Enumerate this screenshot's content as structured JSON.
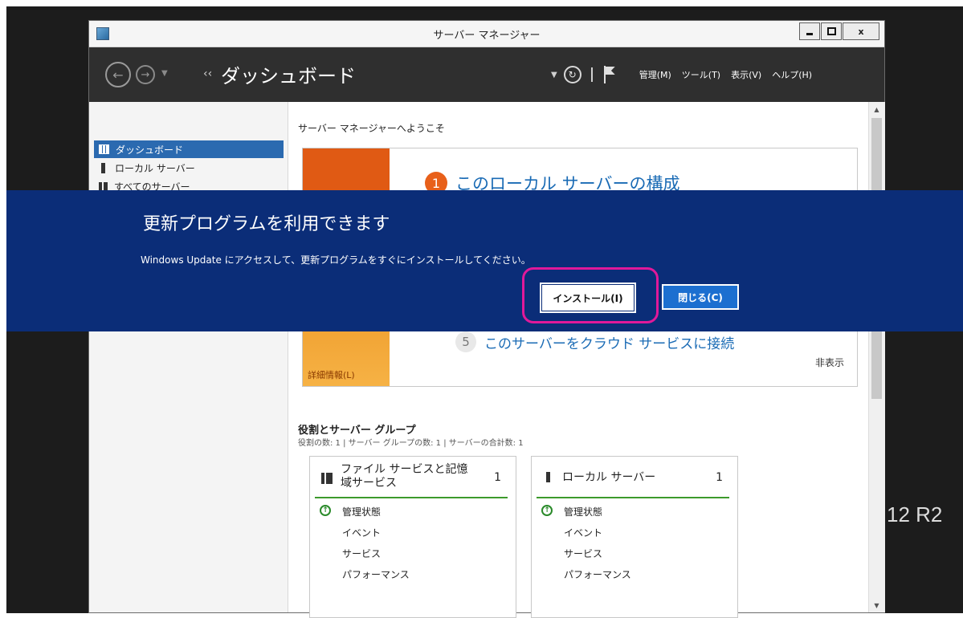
{
  "window": {
    "title": "サーバー マネージャー",
    "min_label": "_",
    "close_label": "x"
  },
  "navbar": {
    "crumb_arrow": "‹‹",
    "breadcrumb": "ダッシュボード",
    "menu": [
      "管理(M)",
      "ツール(T)",
      "表示(V)",
      "ヘルプ(H)"
    ]
  },
  "sidebar": {
    "items": [
      {
        "label": "ダッシュボード",
        "selected": true
      },
      {
        "label": "ローカル サーバー"
      },
      {
        "label": "すべてのサーバー"
      }
    ]
  },
  "content": {
    "welcome": "サーバー マネージャーへようこそ",
    "quick_start": {
      "step1_num": "1",
      "step1_label": "このローカル サーバーの構成",
      "step5_num": "5",
      "step5_label": "このサーバーをクラウド サービスに接続",
      "hide": "非表示",
      "details": "詳細情報(L)"
    },
    "roles": {
      "title": "役割とサーバー グループ",
      "summary": "役割の数: 1 | サーバー グループの数: 1 | サーバーの合計数: 1",
      "tiles": [
        {
          "name": "ファイル サービスと記憶域サービス",
          "count": "1",
          "rows": [
            "管理状態",
            "イベント",
            "サービス",
            "パフォーマンス"
          ]
        },
        {
          "name": "ローカル サーバー",
          "count": "1",
          "rows": [
            "管理状態",
            "イベント",
            "サービス",
            "パフォーマンス"
          ]
        }
      ]
    }
  },
  "banner": {
    "title": "更新プログラムを利用できます",
    "message": "Windows Update にアクセスして、更新プログラムをすぐにインストールしてください。",
    "install_label": "インストール(I)",
    "close_label": "閉じる(C)"
  },
  "desktop": {
    "edition_text": "12 R2"
  },
  "colors": {
    "banner_bg": "#0b2d78",
    "highlight": "#e0199a",
    "accent": "#1c6fd0",
    "navbar_bg": "#2f2f2f"
  }
}
